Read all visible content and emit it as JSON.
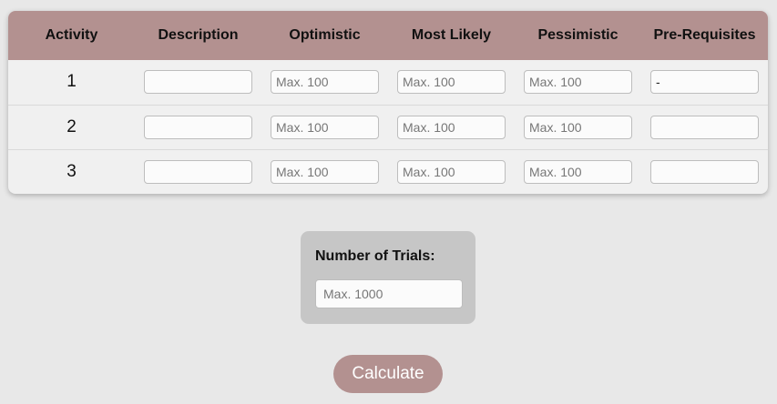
{
  "table": {
    "headers": [
      "Activity",
      "Description",
      "Optimistic",
      "Most Likely",
      "Pessimistic",
      "Pre-Requisites"
    ],
    "rows": [
      {
        "activity": "1",
        "description": "",
        "optimistic_placeholder": "Max. 100",
        "most_likely_placeholder": "Max. 100",
        "pessimistic_placeholder": "Max. 100",
        "prerequisites": "-"
      },
      {
        "activity": "2",
        "description": "",
        "optimistic_placeholder": "Max. 100",
        "most_likely_placeholder": "Max. 100",
        "pessimistic_placeholder": "Max. 100",
        "prerequisites": ""
      },
      {
        "activity": "3",
        "description": "",
        "optimistic_placeholder": "Max. 100",
        "most_likely_placeholder": "Max. 100",
        "pessimistic_placeholder": "Max. 100",
        "prerequisites": ""
      }
    ]
  },
  "trials": {
    "label": "Number of Trials:",
    "placeholder": "Max. 1000"
  },
  "calculate_label": "Calculate",
  "colors": {
    "accent": "#b39190",
    "background": "#e8e8e8",
    "table_body": "#f0f0f0",
    "trials_panel": "#c6c6c6"
  }
}
